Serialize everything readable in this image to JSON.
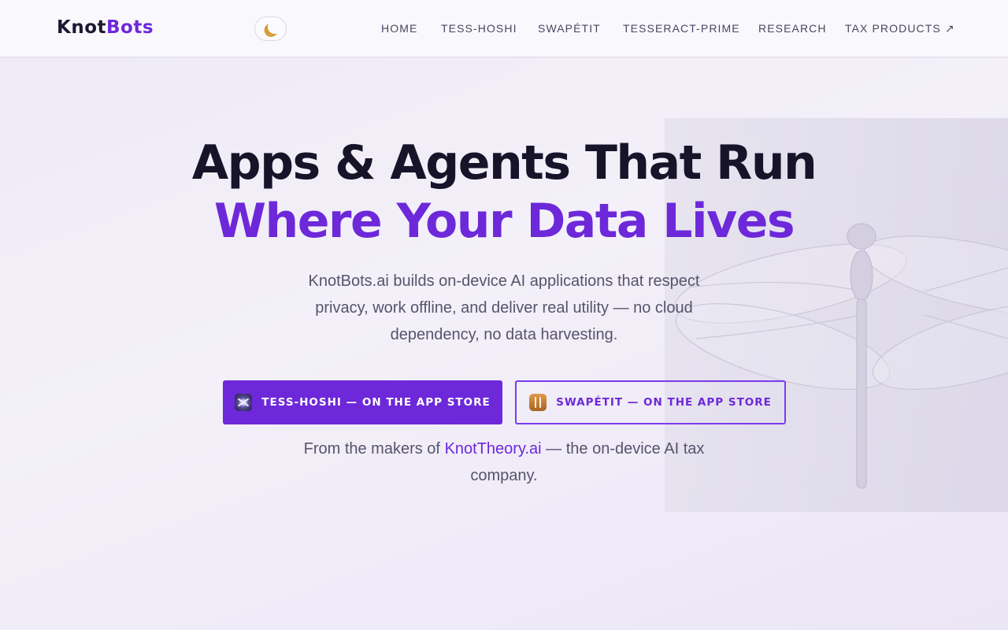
{
  "header": {
    "logo_part1": "Knot",
    "logo_part2": "Bots",
    "theme_toggle_icon": "moon-icon"
  },
  "nav": {
    "items": [
      {
        "label": "HOME"
      },
      {
        "label": "TESS-HOSHI"
      },
      {
        "label": "SWAPÉTIT"
      },
      {
        "label": "TESSERACT-PRIME"
      },
      {
        "label": "RESEARCH"
      },
      {
        "label": "TAX PRODUCTS ↗"
      }
    ]
  },
  "hero": {
    "title_line1": "Apps & Agents That Run",
    "title_line2": "Where Your Data Lives",
    "description": "KnotBots.ai builds on-device AI applications that respect privacy, work offline, and deliver real utility — no cloud dependency, no data harvesting.",
    "primary_cta": "TESS-HOSHI — ON THE APP STORE",
    "secondary_cta": "SWAPÉTIT — ON THE APP STORE",
    "makers_prefix": "From the makers of",
    "makers_link": "KnotTheory.ai",
    "makers_suffix": "— the on-device AI tax company."
  },
  "colors": {
    "accent": "#6d28d9",
    "text_dark": "#17142a",
    "text_muted": "#57536b"
  }
}
